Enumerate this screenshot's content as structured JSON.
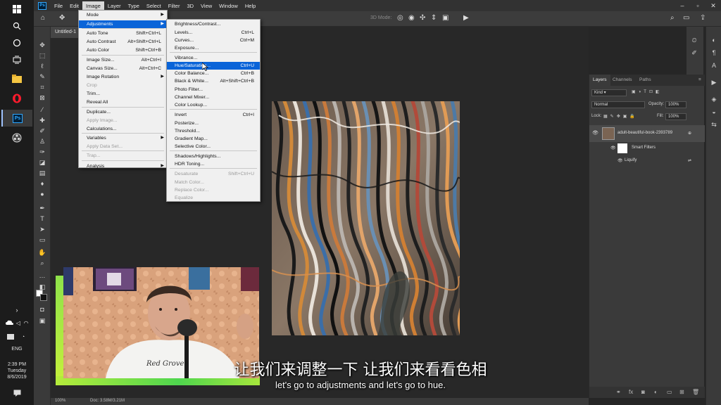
{
  "menubar": {
    "app_logo": "Ps",
    "items": [
      "File",
      "Edit",
      "Image",
      "Layer",
      "Type",
      "Select",
      "Filter",
      "3D",
      "View",
      "Window",
      "Help"
    ],
    "open_item": "Image",
    "mode_3d": "3D Mode:"
  },
  "document": {
    "tab_title": "Untitled-1"
  },
  "image_menu": {
    "items": [
      {
        "label": "Mode",
        "shortcut": "",
        "submenu": true,
        "disabled": false,
        "highlighted": false
      },
      {
        "label": "Adjustments",
        "shortcut": "",
        "submenu": true,
        "disabled": false,
        "highlighted": true
      },
      {
        "label": "Auto Tone",
        "shortcut": "Shift+Ctrl+L",
        "submenu": false,
        "disabled": false,
        "highlighted": false
      },
      {
        "label": "Auto Contrast",
        "shortcut": "Alt+Shift+Ctrl+L",
        "submenu": false,
        "disabled": false,
        "highlighted": false
      },
      {
        "label": "Auto Color",
        "shortcut": "Shift+Ctrl+B",
        "submenu": false,
        "disabled": false,
        "highlighted": false
      },
      {
        "label": "Image Size...",
        "shortcut": "Alt+Ctrl+I",
        "submenu": false,
        "disabled": false,
        "highlighted": false
      },
      {
        "label": "Canvas Size...",
        "shortcut": "Alt+Ctrl+C",
        "submenu": false,
        "disabled": false,
        "highlighted": false
      },
      {
        "label": "Image Rotation",
        "shortcut": "",
        "submenu": true,
        "disabled": false,
        "highlighted": false
      },
      {
        "label": "Crop",
        "shortcut": "",
        "submenu": false,
        "disabled": true,
        "highlighted": false
      },
      {
        "label": "Trim...",
        "shortcut": "",
        "submenu": false,
        "disabled": false,
        "highlighted": false
      },
      {
        "label": "Reveal All",
        "shortcut": "",
        "submenu": false,
        "disabled": false,
        "highlighted": false
      },
      {
        "label": "Duplicate...",
        "shortcut": "",
        "submenu": false,
        "disabled": false,
        "highlighted": false
      },
      {
        "label": "Apply Image...",
        "shortcut": "",
        "submenu": false,
        "disabled": true,
        "highlighted": false
      },
      {
        "label": "Calculations...",
        "shortcut": "",
        "submenu": false,
        "disabled": false,
        "highlighted": false
      },
      {
        "label": "Variables",
        "shortcut": "",
        "submenu": true,
        "disabled": false,
        "highlighted": false
      },
      {
        "label": "Apply Data Set...",
        "shortcut": "",
        "submenu": false,
        "disabled": true,
        "highlighted": false
      },
      {
        "label": "Trap...",
        "shortcut": "",
        "submenu": false,
        "disabled": true,
        "highlighted": false
      },
      {
        "label": "Analysis",
        "shortcut": "",
        "submenu": true,
        "disabled": false,
        "highlighted": false
      }
    ]
  },
  "adjustments_menu": {
    "items": [
      {
        "label": "Brightness/Contrast...",
        "shortcut": "",
        "disabled": false,
        "highlighted": false
      },
      {
        "label": "Levels...",
        "shortcut": "Ctrl+L",
        "disabled": false,
        "highlighted": false
      },
      {
        "label": "Curves...",
        "shortcut": "Ctrl+M",
        "disabled": false,
        "highlighted": false
      },
      {
        "label": "Exposure...",
        "shortcut": "",
        "disabled": false,
        "highlighted": false
      },
      {
        "label": "Vibrance...",
        "shortcut": "",
        "disabled": false,
        "highlighted": false
      },
      {
        "label": "Hue/Saturation...",
        "shortcut": "Ctrl+U",
        "disabled": false,
        "highlighted": true
      },
      {
        "label": "Color Balance...",
        "shortcut": "Ctrl+B",
        "disabled": false,
        "highlighted": false
      },
      {
        "label": "Black & White...",
        "shortcut": "Alt+Shift+Ctrl+B",
        "disabled": false,
        "highlighted": false
      },
      {
        "label": "Photo Filter...",
        "shortcut": "",
        "disabled": false,
        "highlighted": false
      },
      {
        "label": "Channel Mixer...",
        "shortcut": "",
        "disabled": false,
        "highlighted": false
      },
      {
        "label": "Color Lookup...",
        "shortcut": "",
        "disabled": false,
        "highlighted": false
      },
      {
        "label": "Invert",
        "shortcut": "Ctrl+I",
        "disabled": false,
        "highlighted": false
      },
      {
        "label": "Posterize...",
        "shortcut": "",
        "disabled": false,
        "highlighted": false
      },
      {
        "label": "Threshold...",
        "shortcut": "",
        "disabled": false,
        "highlighted": false
      },
      {
        "label": "Gradient Map...",
        "shortcut": "",
        "disabled": false,
        "highlighted": false
      },
      {
        "label": "Selective Color...",
        "shortcut": "",
        "disabled": false,
        "highlighted": false
      },
      {
        "label": "Shadows/Highlights...",
        "shortcut": "",
        "disabled": false,
        "highlighted": false
      },
      {
        "label": "HDR Toning...",
        "shortcut": "",
        "disabled": false,
        "highlighted": false
      },
      {
        "label": "Desaturate",
        "shortcut": "Shift+Ctrl+U",
        "disabled": true,
        "highlighted": false
      },
      {
        "label": "Match Color...",
        "shortcut": "",
        "disabled": true,
        "highlighted": false
      },
      {
        "label": "Replace Color...",
        "shortcut": "",
        "disabled": true,
        "highlighted": false
      },
      {
        "label": "Equalize",
        "shortcut": "",
        "disabled": true,
        "highlighted": false
      }
    ]
  },
  "layers_panel": {
    "tabs": [
      "Layers",
      "Channels",
      "Paths"
    ],
    "active_tab": "Layers",
    "filter_kind": "Kind",
    "blend_mode": "Normal",
    "opacity_label": "Opacity:",
    "opacity_value": "100%",
    "lock_label": "Lock:",
    "fill_label": "Fill:",
    "fill_value": "100%",
    "layer_name": "adult-beautiful-book-2393789",
    "smart_filters_label": "Smart Filters",
    "filter_name": "Liquify"
  },
  "statusbar": {
    "zoom": "100%",
    "doc_info": "Doc: 3.58M/3.21M"
  },
  "taskbar": {
    "language": "ENG",
    "time": "2:39 PM",
    "day": "Tuesday",
    "date": "8/6/2019",
    "ps_label": "Ps"
  },
  "subtitles": {
    "zh": "让我们来调整一下 让我们来看看色相",
    "en": "let's go to adjustments and let's go to hue."
  },
  "colors": {
    "highlight": "#0a64d8",
    "panel_bg": "#3a3a3a",
    "canvas_bg": "#282828",
    "menu_bg": "#f0f0f0"
  }
}
